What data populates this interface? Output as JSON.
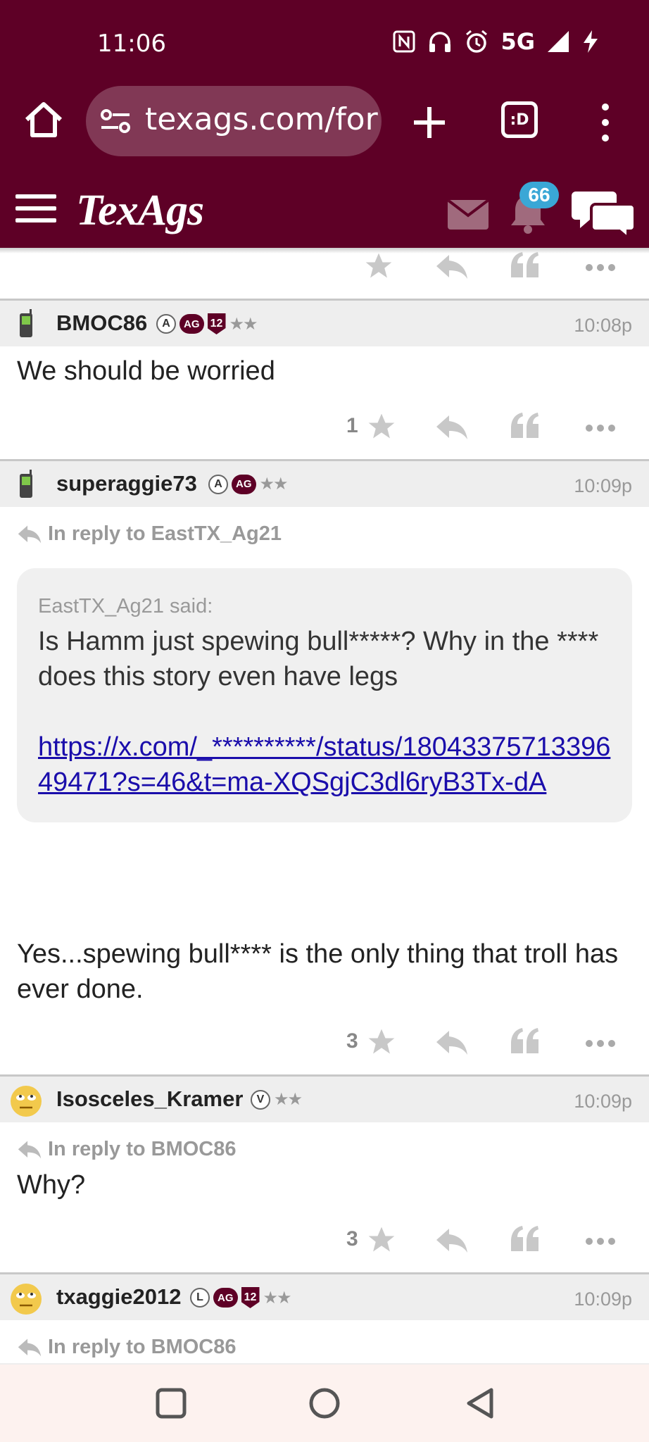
{
  "status": {
    "time": "11:06",
    "network": "5G",
    "icons": [
      "nfc-icon",
      "headphones-icon",
      "alarm-icon",
      "signal-icon",
      "charging-icon"
    ]
  },
  "browser": {
    "url_visible": "texags.com/for",
    "tab_count": ":D"
  },
  "site": {
    "logo": "TexAgs",
    "notification_count": "66",
    "brand_color": "#5e0026"
  },
  "top_actions": {
    "count": ""
  },
  "posts": [
    {
      "username": "BMOC86",
      "badges": [
        "A",
        "AG",
        "12"
      ],
      "stars": "★★",
      "time": "10:08p",
      "text": "We should be worried",
      "likes": "1"
    },
    {
      "username": "superaggie73",
      "badges": [
        "A",
        "AG"
      ],
      "stars": "★★",
      "time": "10:09p",
      "reply_to": "In reply to EastTX_Ag21",
      "quote": {
        "said": "EastTX_Ag21 said:",
        "text": "Is Hamm just spewing bull*****? Why in the **** does this story even have legs",
        "link": "https://x.com/_**********/status/1804337571339649471?s=46&t=ma-XQSgjC3dl6ryB3Tx-dA"
      },
      "text": "Yes...spewing bull**** is the only thing that troll has ever done.",
      "likes": "3"
    },
    {
      "username": "Isosceles_Kramer",
      "badges": [
        "V"
      ],
      "stars": "★★",
      "time": "10:09p",
      "reply_to": "In reply to BMOC86",
      "text": "Why?",
      "likes": "3"
    },
    {
      "username": "txaggie2012",
      "badges": [
        "L",
        "AG",
        "12"
      ],
      "stars": "★★",
      "time": "10:09p",
      "reply_to": "In reply to BMOC86"
    }
  ]
}
